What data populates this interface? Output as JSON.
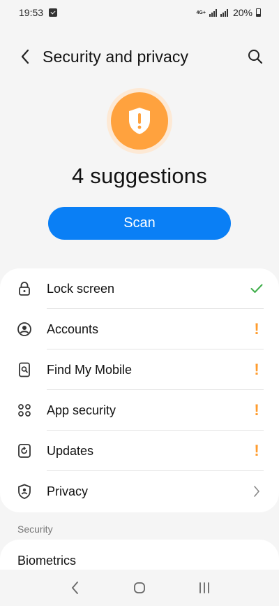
{
  "status_bar": {
    "time": "19:53",
    "network": "4G+",
    "battery": "20%"
  },
  "header": {
    "title": "Security and privacy"
  },
  "summary": {
    "status_icon": "shield-warning-icon",
    "title": "4 suggestions",
    "scan_label": "Scan"
  },
  "colors": {
    "accent": "#0a7ff5",
    "warning": "#ff9c2e",
    "ok": "#3fae4a"
  },
  "items": [
    {
      "label": "Lock screen",
      "icon": "lock-icon",
      "status": "ok"
    },
    {
      "label": "Accounts",
      "icon": "account-icon",
      "status": "warning"
    },
    {
      "label": "Find My Mobile",
      "icon": "find-mobile-icon",
      "status": "warning"
    },
    {
      "label": "App security",
      "icon": "app-security-icon",
      "status": "warning"
    },
    {
      "label": "Updates",
      "icon": "update-icon",
      "status": "warning"
    },
    {
      "label": "Privacy",
      "icon": "privacy-icon",
      "status": "navigate"
    }
  ],
  "warning_glyph": "!",
  "section": {
    "label": "Security",
    "first_item": "Biometrics"
  }
}
